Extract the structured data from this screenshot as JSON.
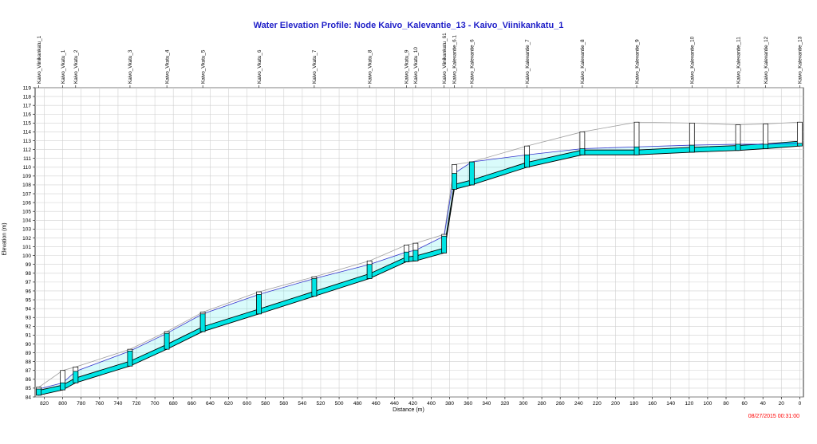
{
  "window": {
    "title": "Water Elevation Profile:  Node Kaivo_Kalevantie_13 - Kaivo_Viinikankatu_1",
    "timestamp": "08/27/2015 00:31:00"
  },
  "colors": {
    "title": "#1f1fc8",
    "water": "#00e5e5",
    "hgl": "#3333cc",
    "ground": "#a0a0a0",
    "grid": "#d0d0d0",
    "timestamp": "#ff0000"
  },
  "chart_data": {
    "type": "line",
    "title": "Water Elevation Profile:  Node Kaivo_Kalevantie_13 - Kaivo_Viinikankatu_1",
    "xlabel": "Distance (m)",
    "ylabel": "Elevation (m)",
    "xlim": [
      830,
      -4
    ],
    "ylim": [
      84,
      119
    ],
    "xticks": [
      820,
      800,
      780,
      760,
      740,
      720,
      700,
      680,
      660,
      640,
      620,
      600,
      580,
      560,
      540,
      520,
      500,
      480,
      460,
      440,
      420,
      400,
      380,
      360,
      340,
      320,
      300,
      280,
      260,
      240,
      220,
      200,
      180,
      160,
      140,
      120,
      100,
      80,
      60,
      40,
      20,
      0
    ],
    "yticks": [
      84,
      85,
      86,
      87,
      88,
      89,
      90,
      91,
      92,
      93,
      94,
      95,
      96,
      97,
      98,
      99,
      100,
      101,
      102,
      103,
      104,
      105,
      106,
      107,
      108,
      109,
      110,
      111,
      112,
      113,
      114,
      115,
      116,
      117,
      118,
      119
    ],
    "grid": true,
    "nodes": [
      {
        "name": "Kaivo_Viinikankatu_1",
        "x": 826,
        "invert": 84.2,
        "ground": 85.1,
        "water": 84.9
      },
      {
        "name": "Kaivo_Vkatu_1",
        "x": 800,
        "invert": 84.8,
        "ground": 87.0,
        "water": 85.6
      },
      {
        "name": "Kaivo_Vkatu_2",
        "x": 786,
        "invert": 85.6,
        "ground": 87.4,
        "water": 86.9
      },
      {
        "name": "Kaivo_Vkatu_3",
        "x": 727,
        "invert": 87.5,
        "ground": 89.4,
        "water": 89.2
      },
      {
        "name": "Kaivo_Vkatu_4",
        "x": 687,
        "invert": 89.4,
        "ground": 91.4,
        "water": 91.2
      },
      {
        "name": "Kaivo_Vkatu_5",
        "x": 648,
        "invert": 91.4,
        "ground": 93.6,
        "water": 93.4
      },
      {
        "name": "Kaivo_Vkatu_6",
        "x": 587,
        "invert": 93.4,
        "ground": 95.9,
        "water": 95.6
      },
      {
        "name": "Kaivo_Vkatu_7",
        "x": 527,
        "invert": 95.4,
        "ground": 97.6,
        "water": 97.4
      },
      {
        "name": "Kaivo_Vkatu_8",
        "x": 467,
        "invert": 97.4,
        "ground": 99.4,
        "water": 99.0
      },
      {
        "name": "Kaivo_Vkatu_9",
        "x": 427,
        "invert": 99.3,
        "ground": 101.2,
        "water": 100.4
      },
      {
        "name": "Kaivo_Vkatu_10",
        "x": 417,
        "invert": 99.4,
        "ground": 101.4,
        "water": 100.6
      },
      {
        "name": "Kaivo_Viinikankatu_61",
        "x": 386,
        "invert": 100.3,
        "ground": 102.4,
        "water": 102.2
      },
      {
        "name": "Kaivo_Kalevantie_6.1",
        "x": 375,
        "invert": 107.5,
        "ground": 110.3,
        "water": 109.3
      },
      {
        "name": "Kaivo_Kalevantie_6",
        "x": 356,
        "invert": 108.0,
        "ground": 110.6,
        "water": 110.6
      },
      {
        "name": "Kaivo_Kalevantie_7",
        "x": 296,
        "invert": 110.0,
        "ground": 112.4,
        "water": 111.4
      },
      {
        "name": "Kaivo_Kalevantie_8",
        "x": 236,
        "invert": 111.4,
        "ground": 114.0,
        "water": 112.1
      },
      {
        "name": "Kaivo_Kalevantie_9",
        "x": 177,
        "invert": 111.4,
        "ground": 115.1,
        "water": 112.3
      },
      {
        "name": "Kaivo_Kalevantie_10",
        "x": 117,
        "invert": 111.7,
        "ground": 115.0,
        "water": 112.5
      },
      {
        "name": "Kaivo_Kalevantie_11",
        "x": 67,
        "invert": 111.9,
        "ground": 114.8,
        "water": 112.6
      },
      {
        "name": "Kaivo_Kalevantie_12",
        "x": 37,
        "invert": 112.1,
        "ground": 114.9,
        "water": 112.6
      },
      {
        "name": "Kaivo_Kalevantie_13",
        "x": 0,
        "invert": 112.4,
        "ground": 115.1,
        "water": 112.7
      }
    ]
  }
}
